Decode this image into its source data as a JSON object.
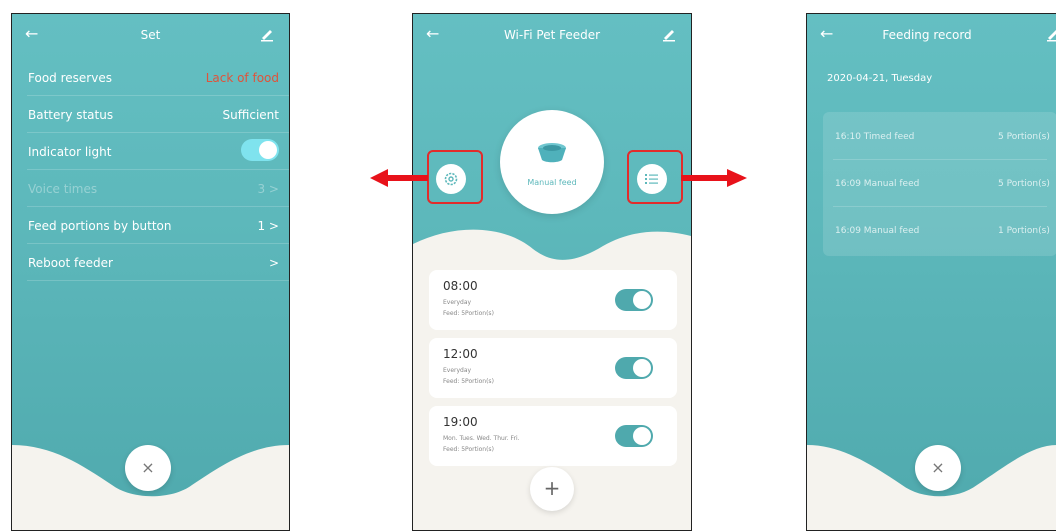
{
  "set_screen": {
    "title": "Set",
    "rows": [
      {
        "label": "Food reserves",
        "value": "Lack of food"
      },
      {
        "label": "Battery status",
        "value": "Sufficient"
      },
      {
        "label": "Indicator light"
      },
      {
        "label": "Voice times",
        "value": "3 >"
      },
      {
        "label": "Feed portions by button",
        "value": "1 >"
      },
      {
        "label": "Reboot feeder",
        "value": ">"
      }
    ],
    "indicator_light_on": true,
    "close_symbol": "×",
    "colors": {
      "alert": "#e0533a",
      "teal": "#5db8bb"
    }
  },
  "feeder_screen": {
    "title": "Wi-Fi Pet Feeder",
    "manual_feed_label": "Manual feed",
    "schedules": [
      {
        "time": "08:00",
        "repeat": "Everyday",
        "feed": "Feed: 5Portion(s)",
        "enabled": true
      },
      {
        "time": "12:00",
        "repeat": "Everyday",
        "feed": "Feed: 5Portion(s)",
        "enabled": true
      },
      {
        "time": "19:00",
        "repeat": "Mon. Tues. Wed. Thur. Fri.",
        "feed": "Feed: 5Portion(s)",
        "enabled": true
      }
    ],
    "add_symbol": "+",
    "icons": [
      "settings-icon",
      "list-icon",
      "bowl-icon"
    ]
  },
  "record_screen": {
    "title": "Feeding record",
    "date": "2020-04-21, Tuesday",
    "records": [
      {
        "event": "16:10 Timed feed",
        "portions": "5 Portion(s)"
      },
      {
        "event": "16:09 Manual feed",
        "portions": "5 Portion(s)"
      },
      {
        "event": "16:09 Manual feed",
        "portions": "1 Portion(s)"
      }
    ],
    "close_symbol": "×"
  },
  "annotation_colors": {
    "highlight": "#e22b2b",
    "arrow": "#e8121a"
  }
}
